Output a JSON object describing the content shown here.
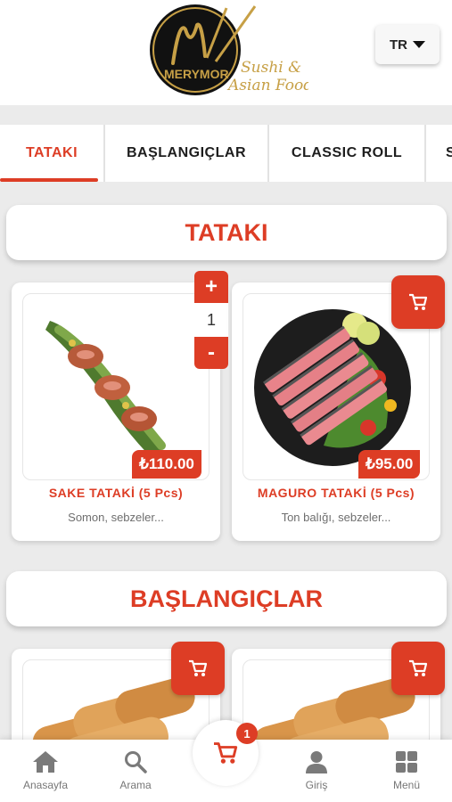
{
  "header": {
    "logo_text": "MERYMOR",
    "logo_tagline_1": "Sushi &",
    "logo_tagline_2": "Asian Food",
    "language": "TR"
  },
  "tabs": [
    {
      "label": "TATAKI",
      "active": true
    },
    {
      "label": "BAŞLANGIÇLAR",
      "active": false
    },
    {
      "label": "CLASSIC ROLL",
      "active": false
    },
    {
      "label": "S",
      "active": false
    }
  ],
  "sections": [
    {
      "title": "TATAKI",
      "items": [
        {
          "name": "SAKE TATAKİ (5 Pcs)",
          "description": "Somon, sebzeler...",
          "price": "₺110.00",
          "quantity": "1"
        },
        {
          "name": "MAGURO TATAKİ (5 Pcs)",
          "description": "Ton balığı, sebzeler...",
          "price": "₺95.00"
        }
      ]
    },
    {
      "title": "BAŞLANGIÇLAR"
    }
  ],
  "stepper": {
    "plus": "+",
    "minus": "-"
  },
  "cart_badge": "1",
  "nav": [
    {
      "label": "Anasayfa",
      "icon": "home-icon"
    },
    {
      "label": "Arama",
      "icon": "search-icon"
    },
    {
      "label": "Giriş",
      "icon": "user-icon"
    },
    {
      "label": "Menü",
      "icon": "grid-icon"
    }
  ],
  "colors": {
    "accent": "#dd3d25",
    "background": "#ebebeb"
  }
}
